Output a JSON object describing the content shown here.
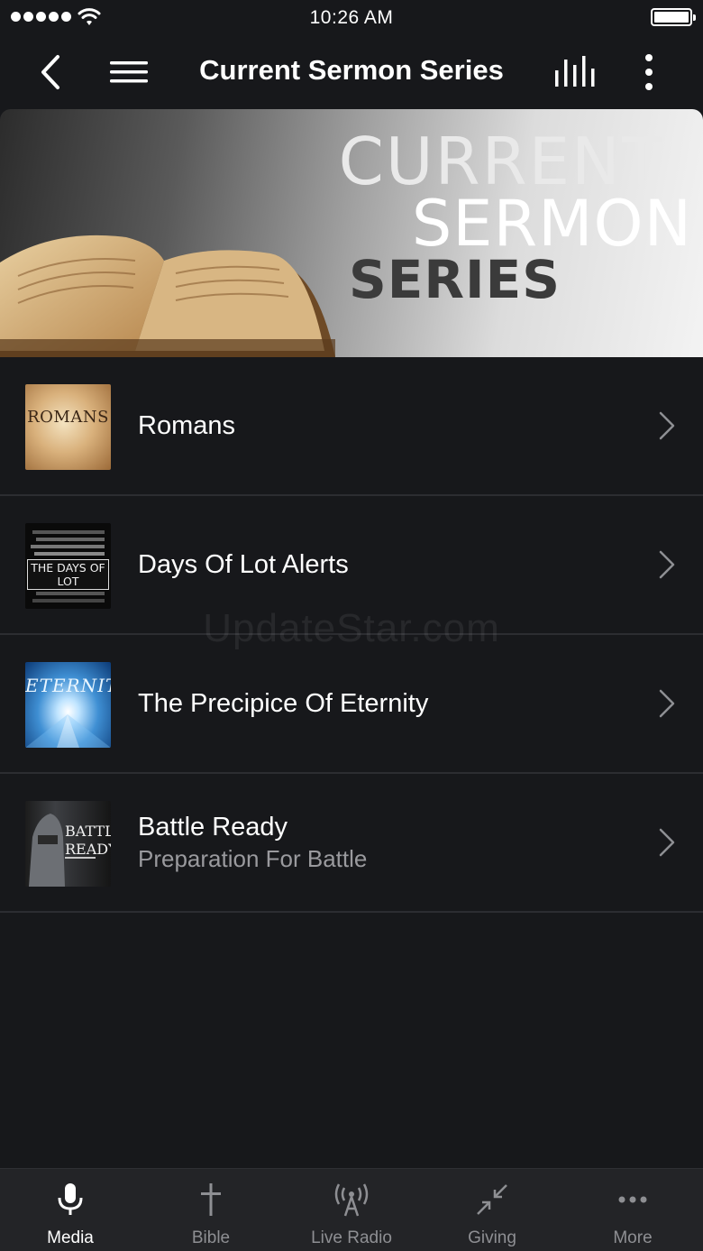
{
  "status_bar": {
    "time": "10:26 AM"
  },
  "nav": {
    "title": "Current Sermon Series"
  },
  "banner": {
    "line1": "CURRENT",
    "line2": "SERMON",
    "line3": "SERIES"
  },
  "series": [
    {
      "title": "Romans",
      "subtitle": "",
      "thumb_text": "ROMANS"
    },
    {
      "title": "Days Of Lot Alerts",
      "subtitle": "",
      "thumb_text": "THE DAYS OF LOT"
    },
    {
      "title": "The Precipice Of Eternity",
      "subtitle": "",
      "thumb_text": "ETERNITY"
    },
    {
      "title": "Battle Ready",
      "subtitle": "Preparation For Battle",
      "thumb_text": "BATTLE READY"
    }
  ],
  "watermark": "UpdateStar.com",
  "tabs": [
    {
      "label": "Media",
      "icon": "microphone-icon",
      "active": true
    },
    {
      "label": "Bible",
      "icon": "cross-icon",
      "active": false
    },
    {
      "label": "Live Radio",
      "icon": "radio-tower-icon",
      "active": false
    },
    {
      "label": "Giving",
      "icon": "compress-arrows-icon",
      "active": false
    },
    {
      "label": "More",
      "icon": "ellipsis-icon",
      "active": false
    }
  ],
  "colors": {
    "background": "#17181b",
    "tab_bar": "#232427",
    "separator": "#2c2d31",
    "inactive_tab": "#8e8f93"
  }
}
